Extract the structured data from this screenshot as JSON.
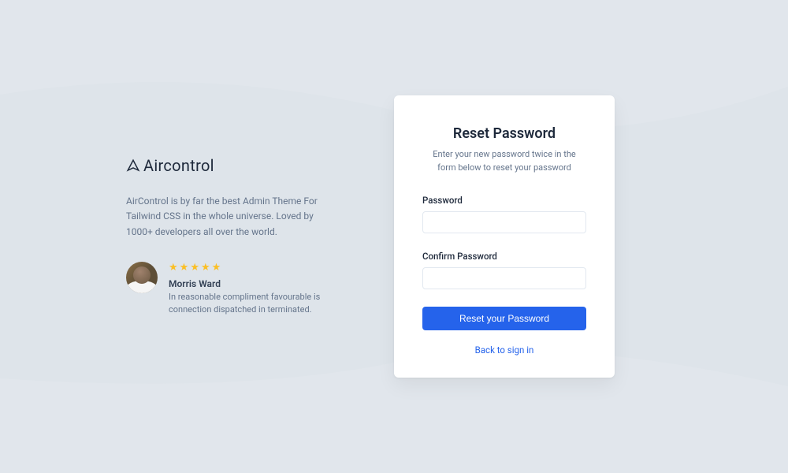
{
  "brand": {
    "name": "Aircontrol"
  },
  "marketing": {
    "tagline": "AirControl is by far the best Admin Theme For Tailwind CSS in the whole universe. Loved by 1000+ developers all over the world."
  },
  "testimonial": {
    "rating": 5,
    "name": "Morris Ward",
    "text": "In reasonable compliment favourable is connection dispatched in terminated."
  },
  "card": {
    "title": "Reset Password",
    "subtitle": "Enter your new password twice in the form below to reset your password",
    "password_label": "Password",
    "confirm_password_label": "Confirm Password",
    "submit_label": "Reset your Password",
    "back_link_label": "Back to sign in"
  },
  "colors": {
    "primary": "#2563eb",
    "background": "#dee4ea",
    "card_bg": "#ffffff",
    "text_dark": "#1e293b",
    "text_muted": "#64748b",
    "star": "#fbbf24"
  }
}
